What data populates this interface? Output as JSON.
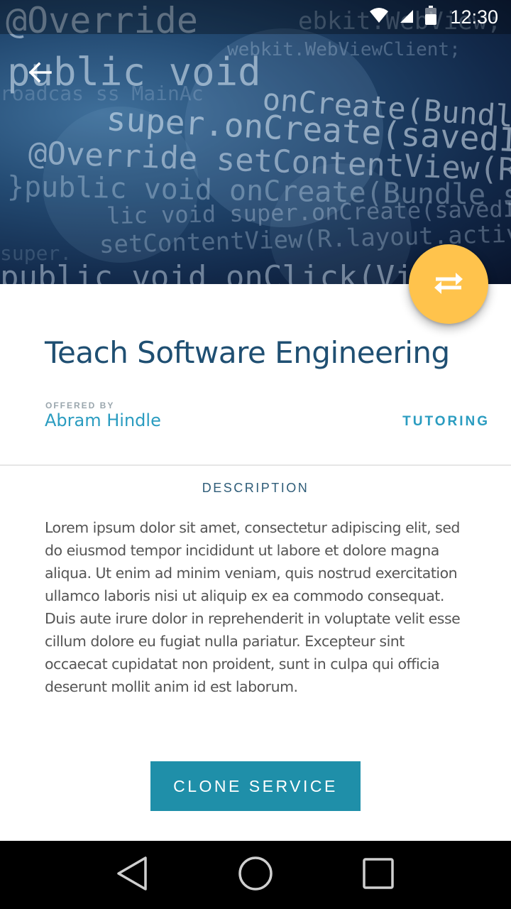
{
  "status_bar": {
    "time": "12:30"
  },
  "header": {
    "code_lines": [
      "@Override",
      "ebkit.WebView; extends",
      "public void",
      "webkit.WebViewClient;",
      "onCreate(Bundle sa",
      "super.onCreate(savedInstan",
      "roadcas ss MainAc",
      "@Override setContentView(R.layout.ac",
      "}public void onCreate(Bundle savedInst",
      "lic void super.onCreate(savedInstanceState)",
      "setContentView(R.layout.activity_m",
      "super.",
      "public void onClick(View"
    ]
  },
  "service": {
    "title": "Teach Software Engineering",
    "offered_by_label": "OFFERED BY",
    "offered_by_name": "Abram Hindle",
    "category": "TUTORING",
    "description_heading": "DESCRIPTION",
    "description": "Lorem ipsum dolor sit amet, consectetur adipiscing elit, sed do eiusmod tempor incididunt ut labore et dolore magna aliqua. Ut enim ad minim veniam, quis nostrud exercitation ullamco laboris nisi ut aliquip ex ea commodo consequat. Duis aute irure dolor in reprehenderit in voluptate velit esse cillum dolore eu fugiat nulla pariatur. Excepteur sint occaecat cupidatat non proident, sunt in culpa qui officia deserunt mollit anim id est laborum.",
    "clone_button_label": "CLONE SERVICE"
  },
  "icons": {
    "back": "arrow-left-icon",
    "fab": "swap-horiz-icon",
    "wifi": "wifi-icon",
    "signal": "signal-icon",
    "battery": "battery-icon",
    "nav_back": "triangle-back-icon",
    "nav_home": "circle-home-icon",
    "nav_recents": "square-recents-icon"
  },
  "colors": {
    "fab": "#ffc34c",
    "accent": "#2a9cc0",
    "button": "#1f8fa9",
    "title": "#1f4f72"
  }
}
